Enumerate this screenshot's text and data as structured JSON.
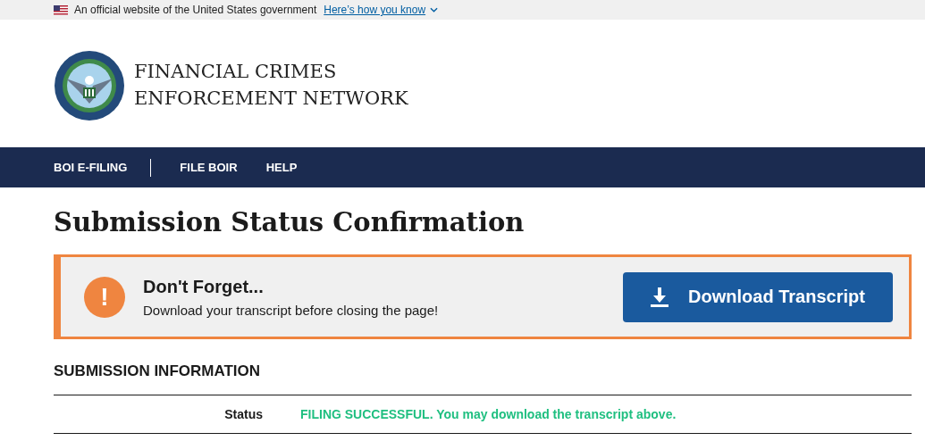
{
  "gov_banner": {
    "text": "An official website of the United States government",
    "link": "Here’s how you know"
  },
  "header": {
    "title_lines": [
      "FINANCIAL CRIMES",
      "ENFORCEMENT NETWORK"
    ]
  },
  "nav_groups": [
    {
      "items": [
        "BOI E-FILING"
      ]
    },
    {
      "items": [
        "FILE BOIR",
        "HELP"
      ]
    }
  ],
  "page_title": "Submission Status Confirmation",
  "alert": {
    "icon": "!",
    "heading": "Don't Forget...",
    "text": "Download your transcript before closing the page!",
    "button": "Download Transcript"
  },
  "section_heading": "SUBMISSION INFORMATION",
  "rows": [
    {
      "label": "Status",
      "value": "FILING SUCCESSFUL. You may download the transcript above."
    }
  ]
}
